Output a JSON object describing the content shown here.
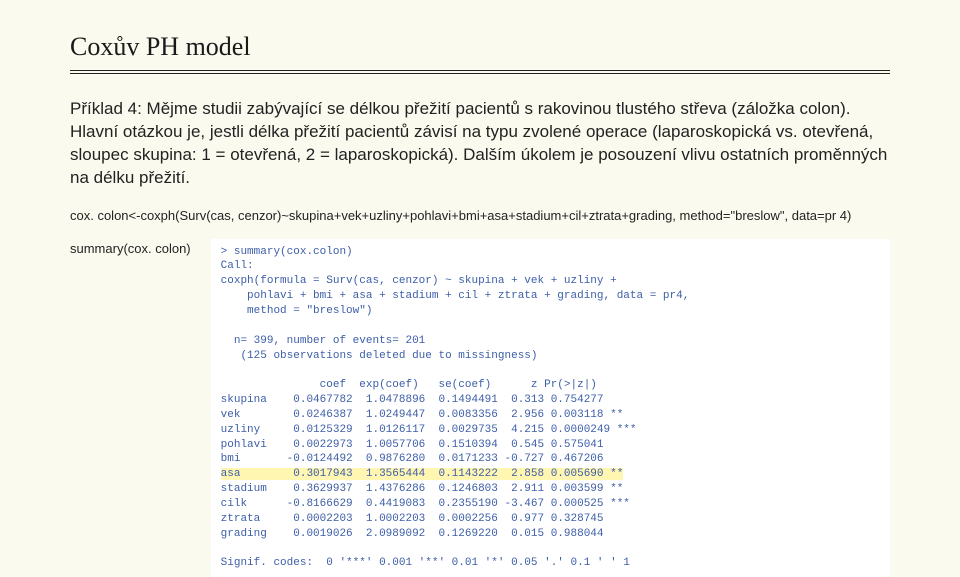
{
  "title": "Coxův PH model",
  "paragraph": "Příklad 4: Mějme studii zabývající se délkou přežití pacientů s rakovinou tlustého střeva (záložka colon). Hlavní otázkou je, jestli délka přežití pacientů závisí na typu zvolené operace (laparoskopická vs. otevřená, sloupec skupina: 1 = otevřená, 2 = laparoskopická). Dalším úkolem je posouzení vlivu ostatních proměnných na délku přežití.",
  "code_line": "cox. colon<-coxph(Surv(cas, cenzor)~skupina+vek+uzliny+pohlavi+bmi+asa+stadium+cil+ztrata+grading, method=\"breslow\", data=pr 4)",
  "summary_call": "summary(cox. colon)",
  "console": {
    "header1": "> summary(cox.colon)",
    "header2": "Call:",
    "header3": "coxph(formula = Surv(cas, cenzor) ~ skupina + vek + uzliny +",
    "header4": "    pohlavi + bmi + asa + stadium + cil + ztrata + grading, data = pr4,",
    "header5": "    method = \"breslow\")",
    "blank": "",
    "nline": "  n= 399, number of events= 201",
    "missing": "   (125 observations deleted due to missingness)",
    "colhead": "               coef  exp(coef)   se(coef)      z Pr(>|z|)",
    "rows": [
      "skupina    0.0467782  1.0478896  0.1494491  0.313 0.754277",
      "vek        0.0246387  1.0249447  0.0083356  2.956 0.003118 **",
      "uzliny     0.0125329  1.0126117  0.0029735  4.215 0.0000249 ***",
      "pohlavi    0.0022973  1.0057706  0.1510394  0.545 0.575041",
      "bmi       -0.0124492  0.9876280  0.0171233 -0.727 0.467206",
      "asa        0.3017943  1.3565444  0.1143222  2.858 0.005690 **",
      "stadium    0.3629937  1.4376286  0.1246803  2.911 0.003599 **",
      "cilk      -0.8166629  0.4419083  0.2355190 -3.467 0.000525 ***",
      "ztrata     0.0002203  1.0002203  0.0002256  0.977 0.328745",
      "grading    0.0019026  2.0989092  0.1269220  0.015 0.988044"
    ],
    "signif": "Signif. codes:  0 '***' 0.001 '**' 0.01 '*' 0.05 '.' 0.1 ' ' 1"
  }
}
